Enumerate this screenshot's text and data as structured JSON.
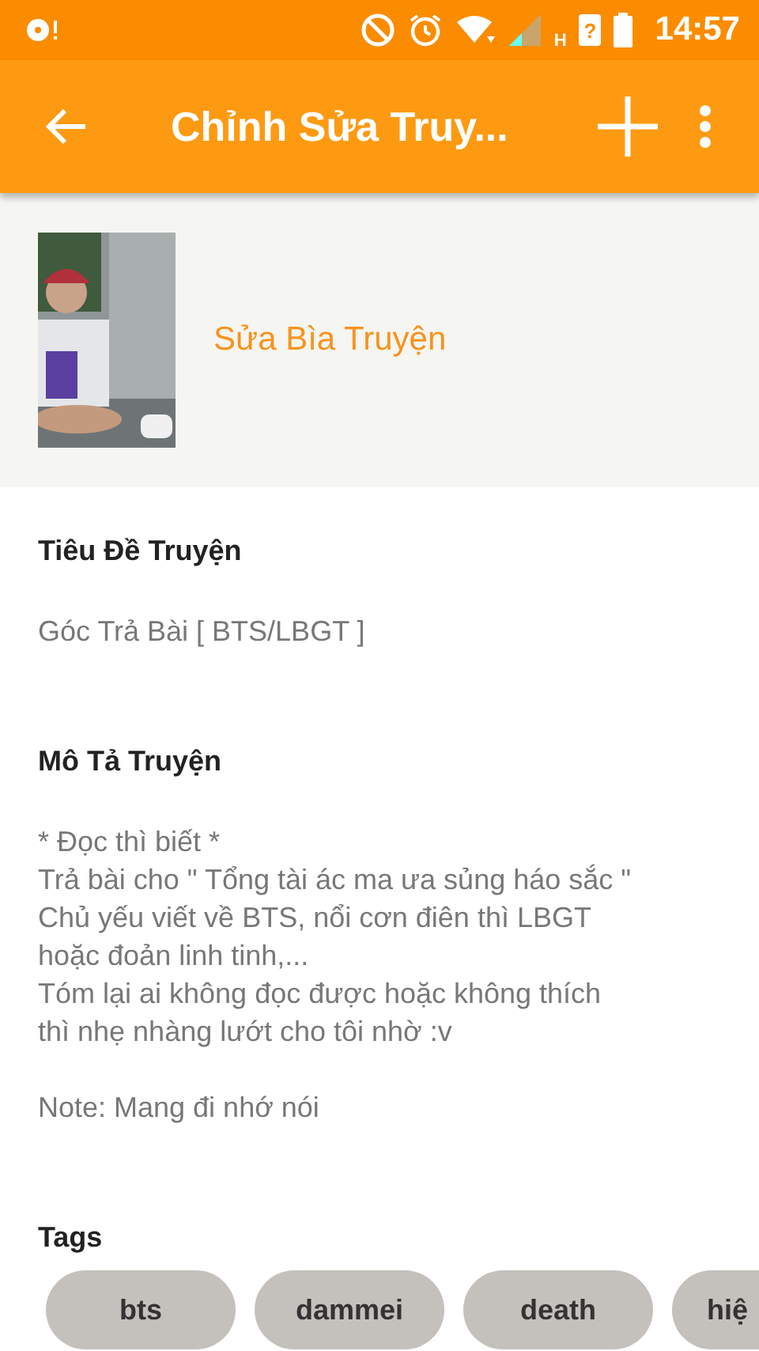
{
  "status_bar": {
    "network_type": "H",
    "sim_mark": "?",
    "time": "14:57"
  },
  "app_bar": {
    "title": "Chỉnh Sửa Truy..."
  },
  "cover": {
    "kind": "picture",
    "action": "Sửa Bìa Truyện"
  },
  "fields": [
    {
      "label": "Tiêu Đề Truyện",
      "value": "Góc Trả Bài [ BTS/LBGT ]"
    },
    {
      "label": "Mô Tả Truyện",
      "value": "* Đọc thì biết *\nTrả bài cho \" Tổng tài ác ma ưa sủng háo sắc \"\nChủ yếu viết về BTS, nổi cơn điên thì LBGT\nhoặc đoản linh tinh,...\nTóm lại ai không đọc được hoặc không thích\nthì nhẹ nhàng lướt cho tôi nhờ :v\n\nNote: Mang đi nhớ nói"
    }
  ],
  "tags": {
    "label": "Tags",
    "items": [
      "bts",
      "dammei",
      "death",
      "hiệ"
    ]
  }
}
